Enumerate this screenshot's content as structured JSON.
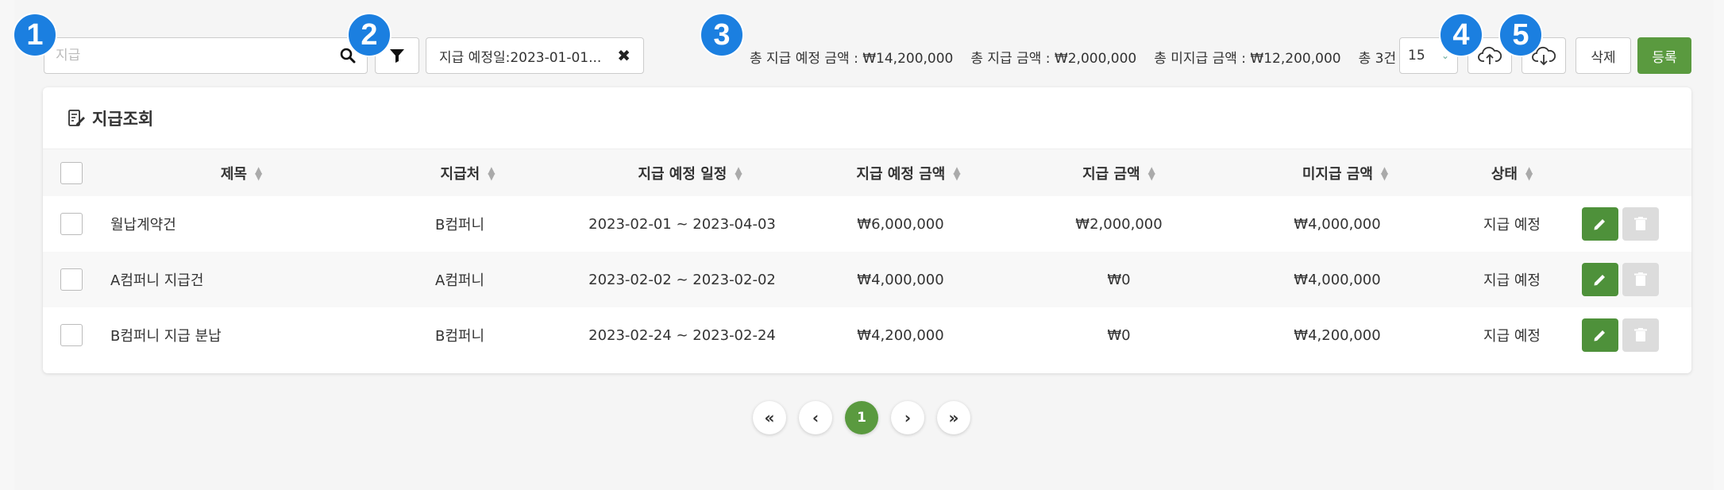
{
  "toolbar": {
    "search_placeholder": "지급",
    "filter_chip_label": "지급 예정일:2023-01-01...",
    "filter_chip_close": "✖",
    "summary": {
      "total_planned": "총 지급 예정 금액 : ₩14,200,000",
      "total_paid": "총 지급 금액 : ₩2,000,000",
      "total_unpaid": "총 미지급 금액 : ₩12,200,000",
      "total_count": "총 3건"
    },
    "page_size": "15",
    "delete_label": "삭제",
    "register_label": "등록"
  },
  "badges": [
    "1",
    "2",
    "3",
    "4",
    "5"
  ],
  "card": {
    "title": "지급조회",
    "columns": [
      "제목",
      "지급처",
      "지급 예정 일정",
      "지급 예정 금액",
      "지급 금액",
      "미지급 금액",
      "상태"
    ],
    "rows": [
      {
        "title": "월납계약건",
        "payee": "B컴퍼니",
        "schedule": "2023-02-01 ~ 2023-04-03",
        "planned": "₩6,000,000",
        "paid": "₩2,000,000",
        "unpaid": "₩4,000,000",
        "status": "지급 예정"
      },
      {
        "title": "A컴퍼니 지급건",
        "payee": "A컴퍼니",
        "schedule": "2023-02-02 ~ 2023-02-02",
        "planned": "₩4,000,000",
        "paid": "₩0",
        "unpaid": "₩4,000,000",
        "status": "지급 예정"
      },
      {
        "title": "B컴퍼니 지급 분납",
        "payee": "B컴퍼니",
        "schedule": "2023-02-24 ~ 2023-02-24",
        "planned": "₩4,200,000",
        "paid": "₩0",
        "unpaid": "₩4,200,000",
        "status": "지급 예정"
      }
    ]
  },
  "pagination": {
    "first": "«",
    "prev": "‹",
    "current": "1",
    "next": "›",
    "last": "»"
  },
  "colors": {
    "accent_green": "#5a9a3f",
    "badge_blue": "#1b7fe0"
  }
}
